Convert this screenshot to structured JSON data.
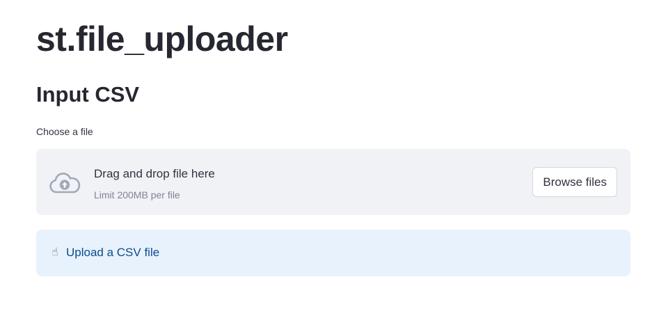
{
  "page": {
    "title": "st.file_uploader",
    "subheader": "Input CSV"
  },
  "uploader": {
    "label": "Choose a file",
    "drop_text": "Drag and drop file here",
    "limit_text": "Limit 200MB per file",
    "browse_label": "Browse files",
    "icon": "cloud-upload-icon"
  },
  "info": {
    "icon": "pointing-up-icon",
    "icon_glyph": "☝",
    "text": "Upload a CSV file"
  },
  "colors": {
    "text": "#31333f",
    "dropzone_bg": "#f0f2f6",
    "info_bg": "#e8f2fc",
    "info_text": "#0d4a8f",
    "muted": "#808495",
    "icon": "#a3a8b8"
  }
}
